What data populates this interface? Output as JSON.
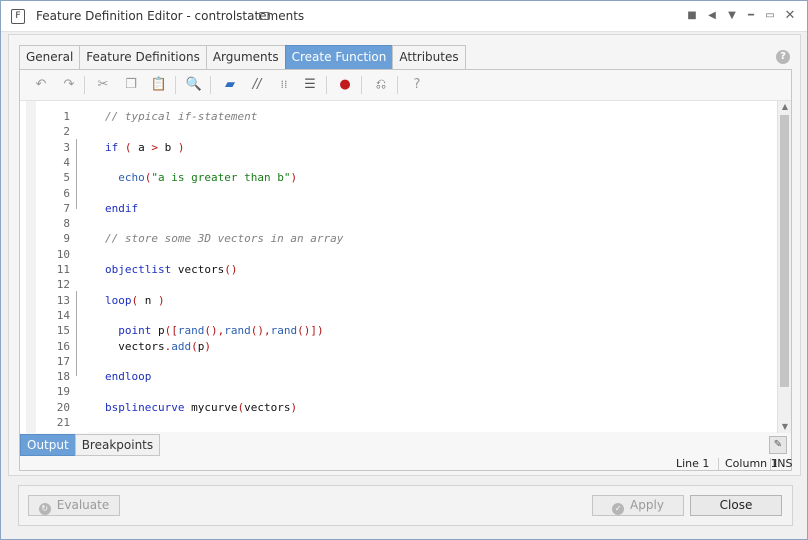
{
  "window": {
    "title": "Feature Definition Editor - controlstatements",
    "app_icon_glyph": "F"
  },
  "tabs": [
    {
      "label": "General"
    },
    {
      "label": "Feature Definitions"
    },
    {
      "label": "Arguments"
    },
    {
      "label": "Create Function",
      "active": true
    },
    {
      "label": "Attributes"
    }
  ],
  "toolbar": {
    "icons": [
      "undo-icon",
      "redo-icon",
      "cut-icon",
      "copy-icon",
      "paste-icon",
      "find-icon",
      "folder-icon",
      "comment-icon",
      "uncomment-icon",
      "indent-icon",
      "toggle-breakpoint-icon",
      "run-to-cursor-icon",
      "help-icon"
    ]
  },
  "editor": {
    "line_numbers": [
      "1",
      "2",
      "3",
      "4",
      "5",
      "6",
      "7",
      "8",
      "9",
      "10",
      "11",
      "12",
      "13",
      "14",
      "15",
      "16",
      "17",
      "18",
      "19",
      "20",
      "21"
    ],
    "lines": [
      {
        "tokens": [
          {
            "t": "// typical if-statement",
            "c": "comment"
          }
        ]
      },
      {
        "tokens": []
      },
      {
        "tokens": [
          {
            "t": "if",
            "c": "kw"
          },
          {
            "t": " ( ",
            "c": "op"
          },
          {
            "t": "a",
            "c": "id"
          },
          {
            "t": " > ",
            "c": "op"
          },
          {
            "t": "b",
            "c": "id"
          },
          {
            "t": " )",
            "c": "op"
          }
        ]
      },
      {
        "tokens": []
      },
      {
        "tokens": [
          {
            "t": "  echo",
            "c": "fn"
          },
          {
            "t": "(",
            "c": "op"
          },
          {
            "t": "\"a is greater than b\"",
            "c": "str"
          },
          {
            "t": ")",
            "c": "op"
          }
        ]
      },
      {
        "tokens": []
      },
      {
        "tokens": [
          {
            "t": "endif",
            "c": "kw"
          }
        ]
      },
      {
        "tokens": []
      },
      {
        "tokens": [
          {
            "t": "// store some 3D vectors in an array",
            "c": "comment"
          }
        ]
      },
      {
        "tokens": []
      },
      {
        "tokens": [
          {
            "t": "objectlist",
            "c": "kw"
          },
          {
            "t": " vectors",
            "c": "id"
          },
          {
            "t": "()",
            "c": "op"
          }
        ]
      },
      {
        "tokens": []
      },
      {
        "tokens": [
          {
            "t": "loop",
            "c": "kw"
          },
          {
            "t": "( ",
            "c": "op"
          },
          {
            "t": "n",
            "c": "id"
          },
          {
            "t": " )",
            "c": "op"
          }
        ]
      },
      {
        "tokens": []
      },
      {
        "tokens": [
          {
            "t": "  point",
            "c": "kw"
          },
          {
            "t": " p",
            "c": "id"
          },
          {
            "t": "([",
            "c": "op"
          },
          {
            "t": "rand",
            "c": "fn"
          },
          {
            "t": "(),",
            "c": "op"
          },
          {
            "t": "rand",
            "c": "fn"
          },
          {
            "t": "(),",
            "c": "op"
          },
          {
            "t": "rand",
            "c": "fn"
          },
          {
            "t": "()])",
            "c": "op"
          }
        ]
      },
      {
        "tokens": [
          {
            "t": "  vectors",
            "c": "id"
          },
          {
            "t": ".",
            "c": "op"
          },
          {
            "t": "add",
            "c": "fn"
          },
          {
            "t": "(",
            "c": "op"
          },
          {
            "t": "p",
            "c": "id"
          },
          {
            "t": ")",
            "c": "op"
          }
        ]
      },
      {
        "tokens": []
      },
      {
        "tokens": [
          {
            "t": "endloop",
            "c": "kw"
          }
        ]
      },
      {
        "tokens": []
      },
      {
        "tokens": [
          {
            "t": "bsplinecurve",
            "c": "kw"
          },
          {
            "t": " mycurve",
            "c": "id"
          },
          {
            "t": "(",
            "c": "op"
          },
          {
            "t": "vectors",
            "c": "id"
          },
          {
            "t": ")",
            "c": "op"
          }
        ]
      },
      {
        "tokens": []
      }
    ]
  },
  "output_tabs": [
    {
      "label": "Output",
      "active": true
    },
    {
      "label": "Breakpoints"
    }
  ],
  "status": {
    "line": "Line 1",
    "column": "Column 1",
    "mode": "INS"
  },
  "footer": {
    "evaluate_label": "Evaluate",
    "apply_label": "Apply",
    "close_label": "Close"
  }
}
